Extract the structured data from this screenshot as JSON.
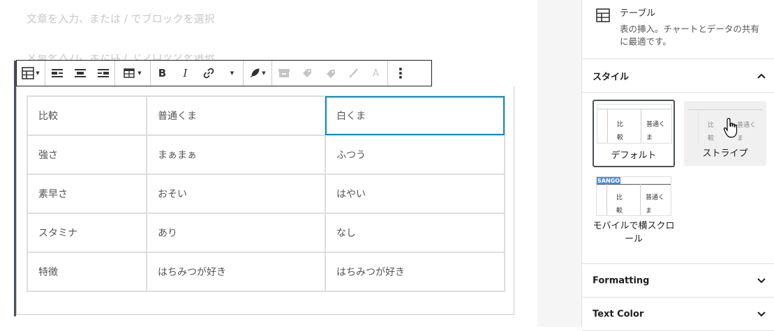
{
  "editor": {
    "placeholder": "文章を入力、または / でブロックを選択",
    "placeholder_2": "文章を入力、または / でブロックを選択"
  },
  "toolbar": {
    "groups": [
      [
        "table-icon"
      ],
      [
        "align-left-icon",
        "align-center-icon",
        "align-right-icon"
      ],
      [
        "edit-table-icon"
      ],
      [
        "bold-icon",
        "italic-icon",
        "link-icon",
        "more-rich-text-icon"
      ],
      [
        "feather-icon"
      ],
      [
        "archive-icon",
        "tag-icon",
        "tags-icon",
        "brush-icon",
        "font-icon"
      ],
      [
        "more-options-icon"
      ]
    ],
    "bold": "B",
    "italic": "I",
    "font": "A",
    "more": "⋮"
  },
  "table": {
    "rows": [
      [
        "比較",
        "普通くま",
        "白くま"
      ],
      [
        "強さ",
        "まぁまぁ",
        "ふつう"
      ],
      [
        "素早さ",
        "おそい",
        "はやい"
      ],
      [
        "スタミナ",
        "あり",
        "なし"
      ],
      [
        "特徴",
        "はちみつが好き",
        "はちみつが好き"
      ]
    ]
  },
  "sidebar": {
    "block_card": {
      "title": "テーブル",
      "description": "表の挿入。チャートとデータの共有に最適です。"
    },
    "styles": {
      "heading": "スタイル",
      "options": [
        {
          "label": "デフォルト",
          "selected": true
        },
        {
          "label": "ストライプ",
          "selected": false
        },
        {
          "label": "モバイルで横スクロール",
          "badge": "SANGO",
          "selected": false
        }
      ],
      "preview_text": {
        "cell_a": "比",
        "cell_b": "較",
        "cell_c": "普通く",
        "cell_d": "ま"
      }
    },
    "formatting": {
      "heading": "Formatting"
    },
    "text_color": {
      "heading": "Text Color"
    }
  },
  "colors": {
    "accent": "#0e8bc0",
    "selected_border": "#4b5158",
    "sango_badge": "#4a90d9"
  }
}
